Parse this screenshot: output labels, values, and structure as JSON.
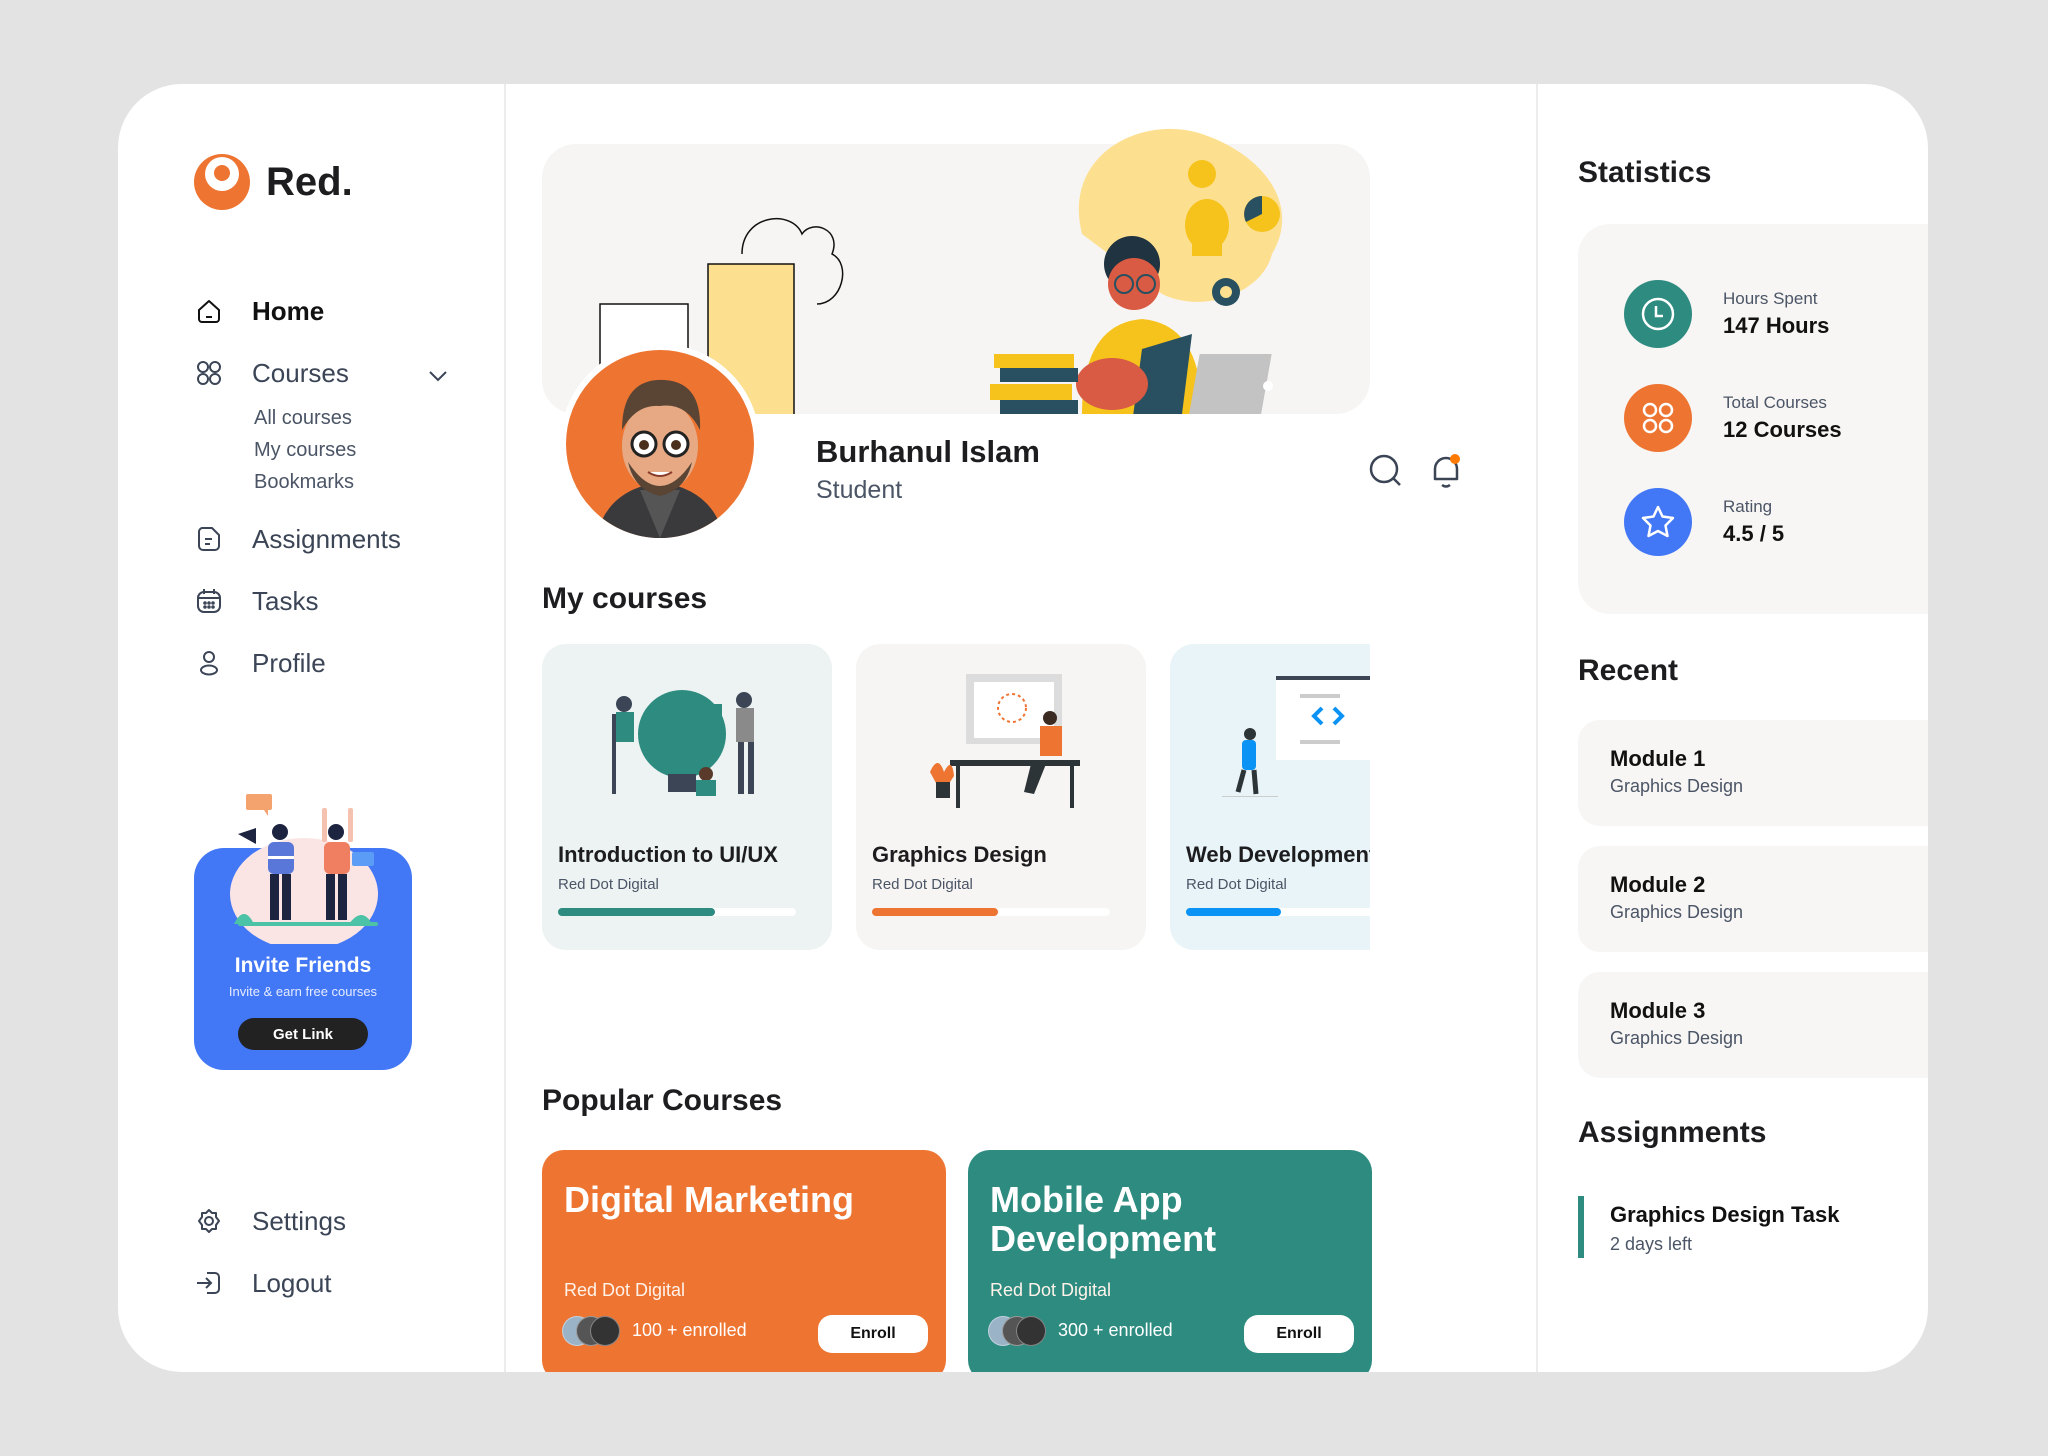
{
  "brand": {
    "name": "Red.",
    "accent": "#ee7431"
  },
  "sidebar": {
    "items": [
      {
        "label": "Home",
        "icon": "home-icon",
        "active": true
      },
      {
        "label": "Courses",
        "icon": "grid-icon",
        "expanded": true,
        "children": [
          "All courses",
          "My courses",
          "Bookmarks"
        ]
      },
      {
        "label": "Assignments",
        "icon": "document-icon"
      },
      {
        "label": "Tasks",
        "icon": "calendar-icon"
      },
      {
        "label": "Profile",
        "icon": "user-icon"
      }
    ],
    "invite": {
      "title": "Invite Friends",
      "subtitle": "Invite & earn free courses",
      "button": "Get Link",
      "color": "#4277f6"
    },
    "bottom": [
      {
        "label": "Settings",
        "icon": "gear-icon"
      },
      {
        "label": "Logout",
        "icon": "logout-icon"
      }
    ]
  },
  "profile": {
    "name": "Burhanul Islam",
    "role": "Student",
    "notification_dot": true
  },
  "my_courses": {
    "title": "My courses",
    "items": [
      {
        "title": "Introduction to UI/UX",
        "org": "Red Dot Digital",
        "progress": 0.66,
        "color": "#2e8b80",
        "bg": "#ecf3f2"
      },
      {
        "title": "Graphics Design",
        "org": "Red Dot Digital",
        "progress": 0.53,
        "color": "#ee7431",
        "bg": "#f6f5f3"
      },
      {
        "title": "Web Development",
        "org": "Red Dot Digital",
        "progress": 0.4,
        "color": "#0a92f5",
        "bg": "#e8f4f8"
      }
    ]
  },
  "popular": {
    "title": "Popular Courses",
    "items": [
      {
        "title": "Digital Marketing",
        "org": "Red Dot Digital",
        "enrolled": "100 + enrolled",
        "button": "Enroll",
        "color": "#ee7431"
      },
      {
        "title": "Mobile App Development",
        "org": "Red Dot Digital",
        "enrolled": "300 + enrolled",
        "button": "Enroll",
        "color": "#2e8b80"
      }
    ]
  },
  "statistics": {
    "title": "Statistics",
    "items": [
      {
        "label": "Hours Spent",
        "value": "147 Hours",
        "icon": "clock-icon",
        "color": "#2e8b80"
      },
      {
        "label": "Total Courses",
        "value": "12 Courses",
        "icon": "grid-icon",
        "color": "#ee7431"
      },
      {
        "label": "Rating",
        "value": "4.5 / 5",
        "icon": "star-icon",
        "color": "#4277f6"
      }
    ]
  },
  "recent": {
    "title": "Recent",
    "items": [
      {
        "title": "Module 1",
        "subtitle": "Graphics Design"
      },
      {
        "title": "Module 2",
        "subtitle": "Graphics Design"
      },
      {
        "title": "Module 3",
        "subtitle": "Graphics Design"
      }
    ]
  },
  "assignments": {
    "title": "Assignments",
    "items": [
      {
        "title": "Graphics Design Task",
        "subtitle": "2 days left",
        "color": "#2e8b80"
      }
    ]
  }
}
